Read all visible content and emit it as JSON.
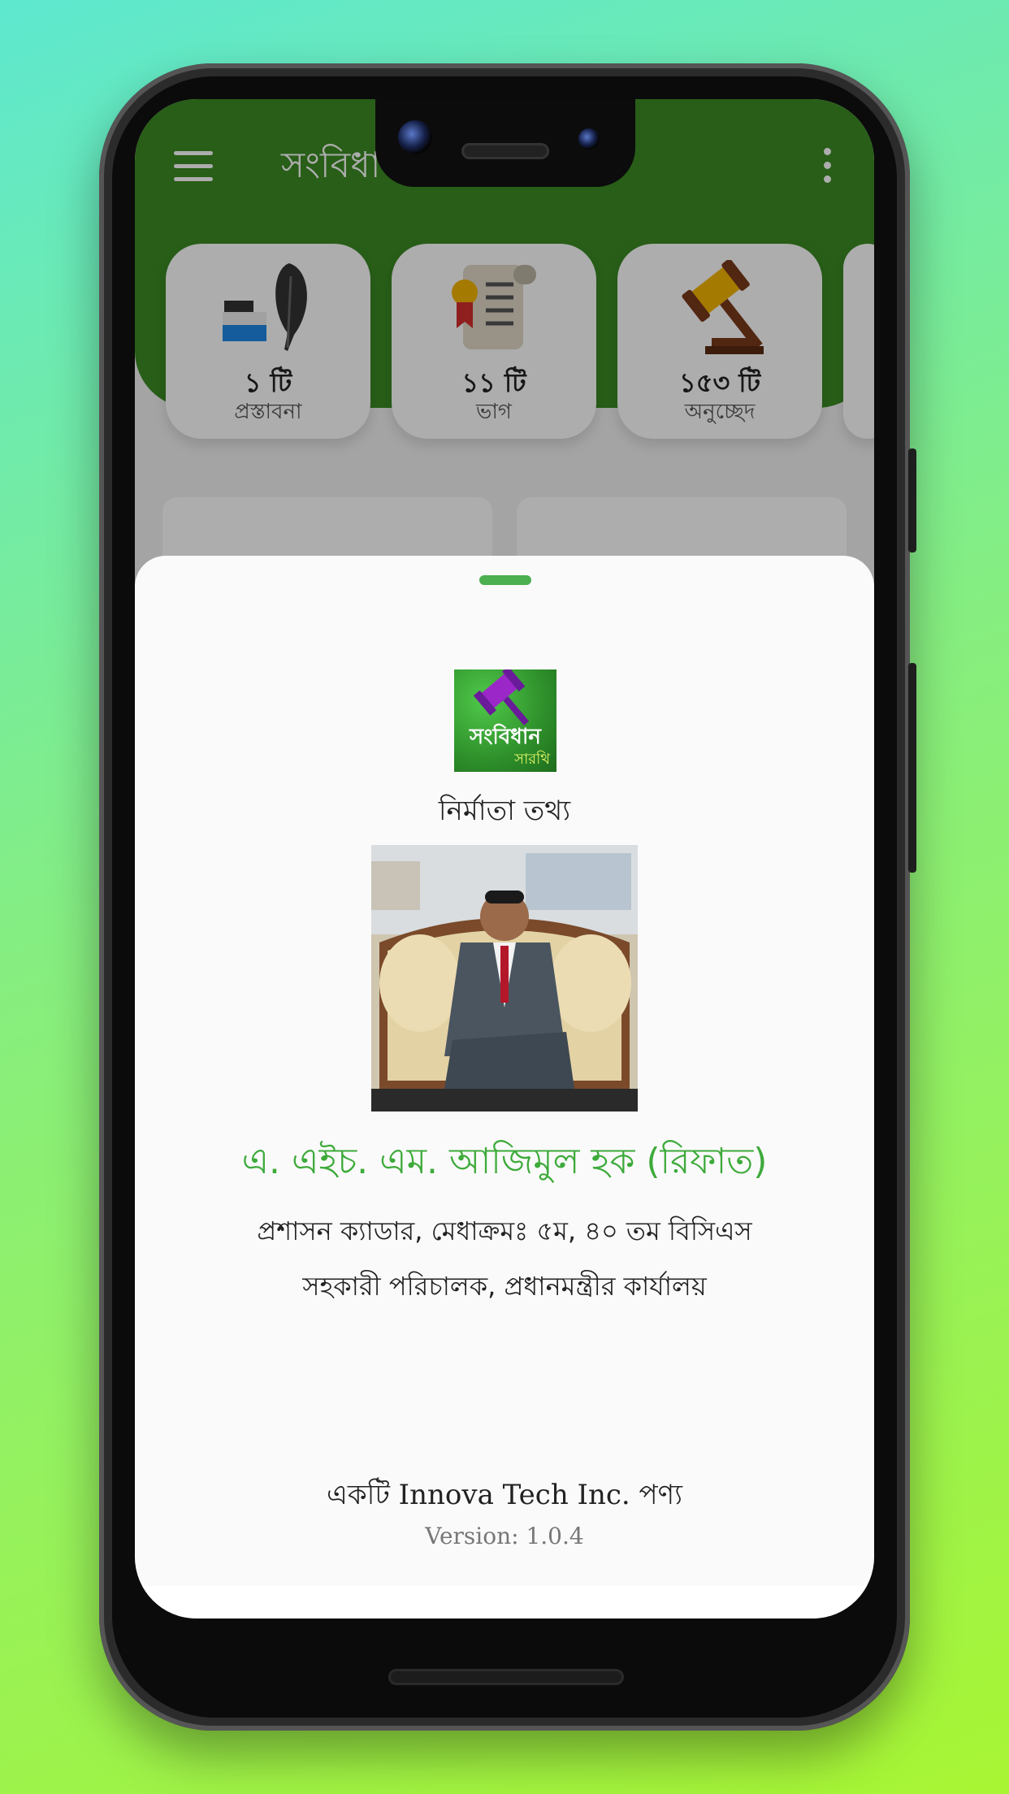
{
  "app": {
    "title": "সংবিধা",
    "stats": [
      {
        "count": "১ টি",
        "label": "প্রস্তাবনা",
        "icon": "ink-quill-icon"
      },
      {
        "count": "১১ টি",
        "label": "ভাগ",
        "icon": "scroll-certificate-icon"
      },
      {
        "count": "১৫৩ টি",
        "label": "অনুচ্ছেদ",
        "icon": "gavel-icon"
      }
    ]
  },
  "sheet": {
    "title": "নির্মাতা তথ্য",
    "developer_name": "এ. এইচ. এম. আজিমুল হক (রিফাত)",
    "line1": "প্রশাসন ক্যাডার, মেধাক্রমঃ ৫ম, ৪০ তম বিসিএস",
    "line2": "সহকারী পরিচালক, প্রধানমন্ত্রীর কার্যালয়",
    "company": "একটি Innova Tech Inc. পণ্য",
    "version": "Version: 1.0.4",
    "logo_text": "সংবিধান",
    "logo_sub": "সারথি"
  },
  "colors": {
    "accent": "#4caf50",
    "name_green": "#3daa3a",
    "toolbar_green": "#3b8b24"
  }
}
